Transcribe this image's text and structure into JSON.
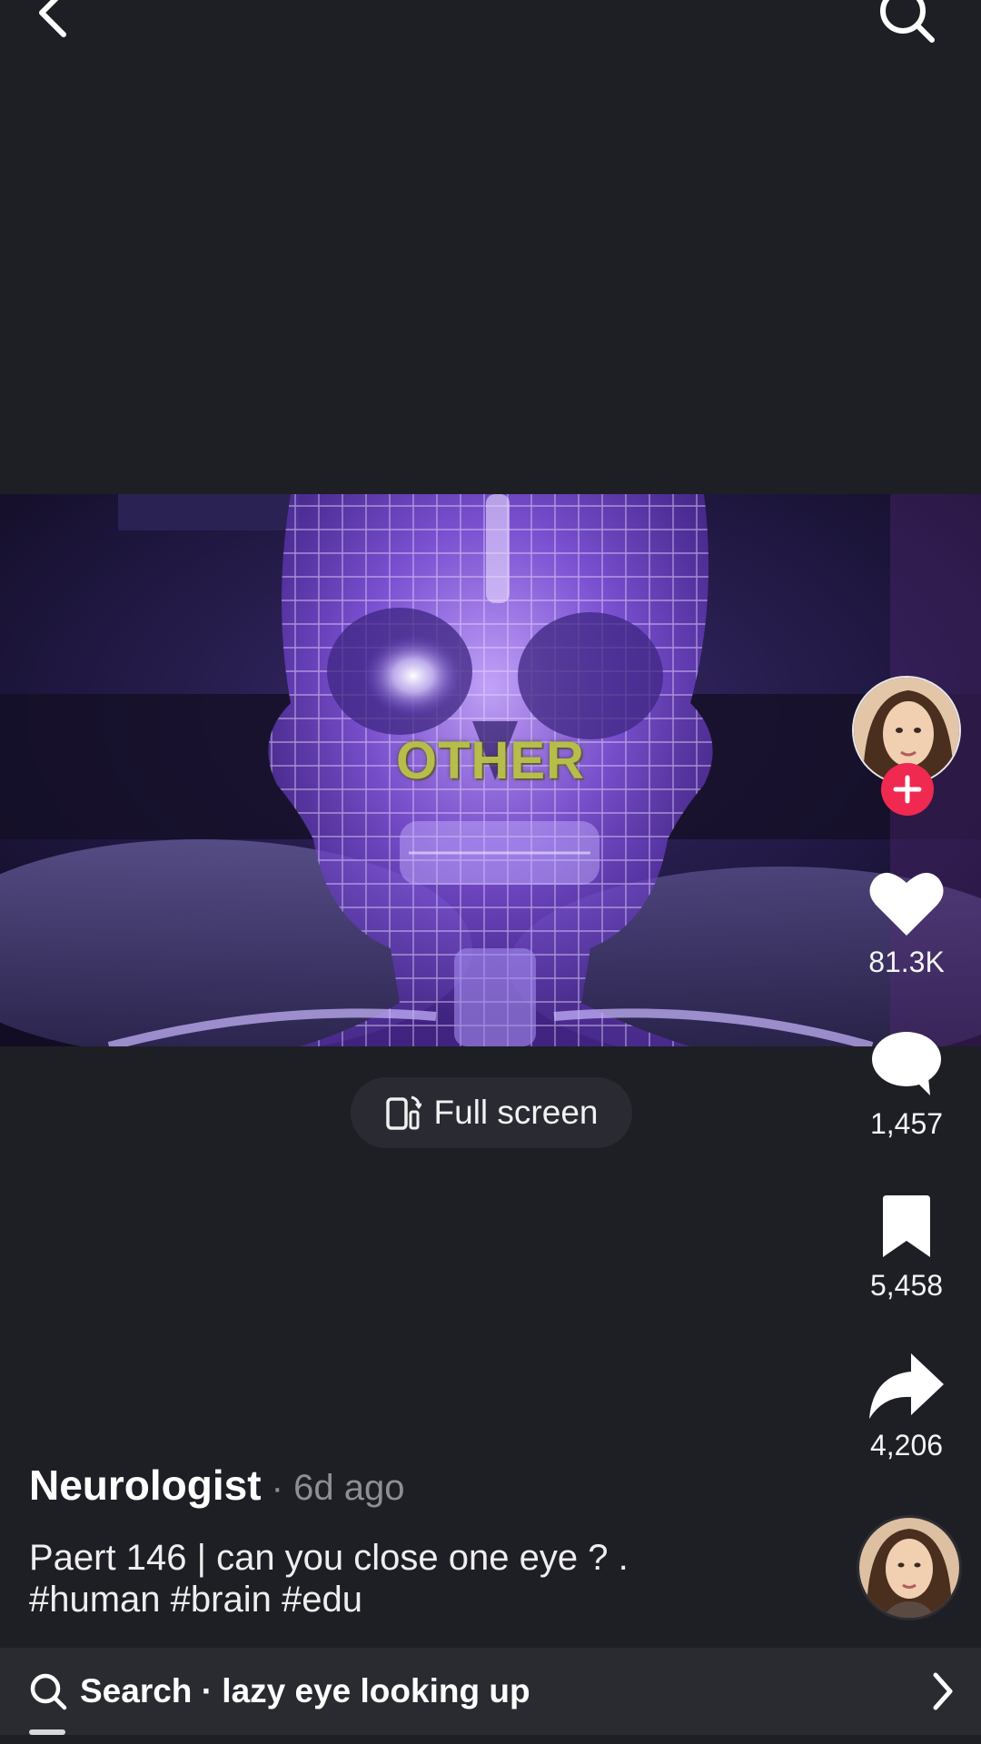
{
  "top_bar": {
    "back_icon": "chevron-left-icon",
    "search_icon": "search-icon"
  },
  "video": {
    "overlay_text": "OTHER"
  },
  "fullscreen": {
    "label": "Full screen",
    "icon": "rotate-phone-icon"
  },
  "actions": {
    "likes": "81.3K",
    "comments": "1,457",
    "saves": "5,458",
    "shares": "4,206"
  },
  "post": {
    "author": "Neurologist",
    "age": " · 6d ago",
    "caption_line1": "Paert 146 | can you close one eye ?   .",
    "caption_line2": "#human #brain #edu"
  },
  "search_bar": {
    "text": "Search · lazy eye looking up"
  },
  "colors": {
    "background": "#1e1f25",
    "follow": "#ef2950",
    "overlay": "#b7bd4a"
  }
}
